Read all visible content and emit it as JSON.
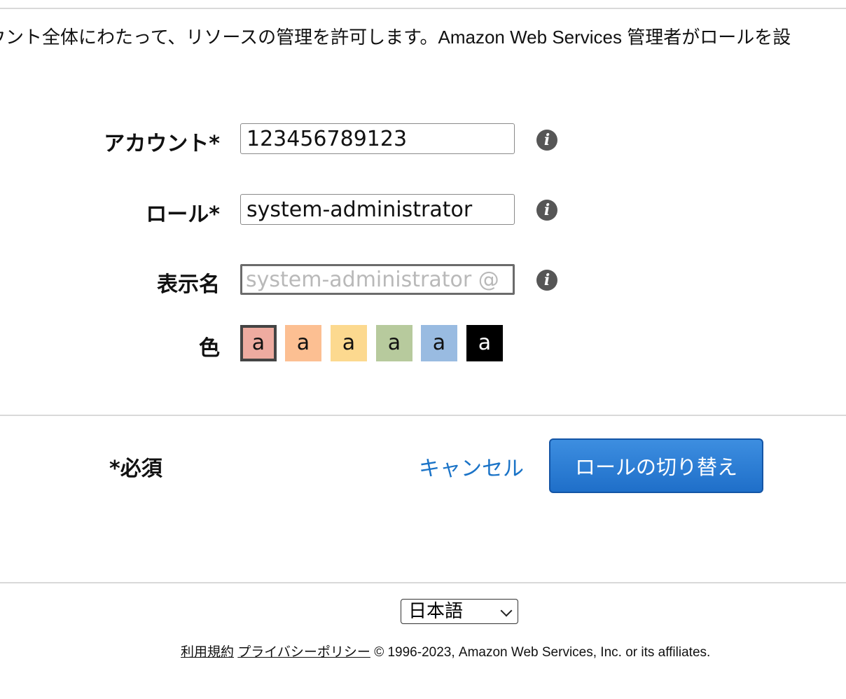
{
  "intro_text": "ウント全体にわたって、リソースの管理を許可します。Amazon Web Services 管理者がロールを設",
  "form": {
    "account_label": "アカウント*",
    "account_value": "123456789123",
    "role_label": "ロール*",
    "role_value": "system-administrator",
    "display_name_label": "表示名",
    "display_name_placeholder": "system-administrator @",
    "color_label": "色",
    "swatches": [
      {
        "text": "a",
        "color": "#eeaba0",
        "selected": true
      },
      {
        "text": "a",
        "color": "#fcbf92"
      },
      {
        "text": "a",
        "color": "#fcd98f"
      },
      {
        "text": "a",
        "color": "#b7ca9d"
      },
      {
        "text": "a",
        "color": "#99bbe1"
      },
      {
        "text": "a",
        "color": "#000000",
        "text_color": "#ffffff"
      }
    ]
  },
  "actions": {
    "required_note": "*必須",
    "cancel_label": "キャンセル",
    "switch_role_label": "ロールの切り替え"
  },
  "footer": {
    "language": "日本語",
    "terms_link": "利用規約",
    "privacy_link": "プライバシーポリシー",
    "copyright": "© 1996-2023, Amazon Web Services, Inc. or its affiliates."
  },
  "icons": {
    "info": "info-icon",
    "info_glyph": "i"
  },
  "colors": {
    "accent": "#1f6fc9",
    "link": "#1a73c7"
  }
}
